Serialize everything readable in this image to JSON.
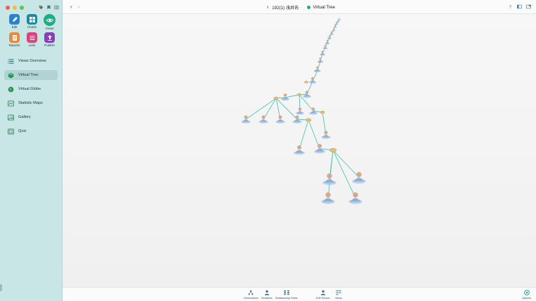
{
  "window": {
    "traffic_lights": [
      "close",
      "minimize",
      "maximize"
    ],
    "toolbar_icons": [
      "tag-icon",
      "bookmark-icon",
      "search-window-icon"
    ]
  },
  "sidebar": {
    "tools": [
      {
        "label": "Edit",
        "icon": "pencil-icon",
        "color": "#2a83cc"
      },
      {
        "label": "Charts",
        "icon": "charts-icon",
        "color": "#1f8a9e"
      },
      {
        "label": "Views",
        "icon": "eye-icon",
        "color": "#1fad84",
        "active": true
      },
      {
        "label": "Reports",
        "icon": "reports-icon",
        "color": "#e88a3a"
      },
      {
        "label": "Lists",
        "icon": "lists-icon",
        "color": "#d6457c"
      },
      {
        "label": "Publish",
        "icon": "publish-icon",
        "color": "#8a3fb8"
      }
    ],
    "nav": [
      {
        "label": "Views Overview",
        "icon": "list-icon"
      },
      {
        "label": "Virtual Tree",
        "icon": "tree-cube-icon",
        "active": true
      },
      {
        "label": "Virtual Globe",
        "icon": "globe-icon"
      },
      {
        "label": "Statistic Maps",
        "icon": "map-icon"
      },
      {
        "label": "Gallery",
        "icon": "gallery-icon"
      },
      {
        "label": "Quiz",
        "icon": "quiz-icon"
      }
    ]
  },
  "header": {
    "back": "‹",
    "forward": "›",
    "person": "192(1) 浅井氏",
    "view_title": "Virtual Tree",
    "right_icons": [
      "help-icon",
      "sidebar-icon",
      "fullscreen-icon"
    ]
  },
  "bottom": {
    "tools": [
      {
        "label": "Generations",
        "icon": "generations-icon"
      },
      {
        "label": "Relatives",
        "icon": "relatives-icon"
      },
      {
        "label": "Relationship Paths",
        "icon": "relationship-paths-icon"
      },
      {
        "label": "Edit Person",
        "icon": "edit-person-icon"
      },
      {
        "label": "Views",
        "icon": "views-icon"
      },
      {
        "label": "Options",
        "icon": "options-icon"
      }
    ]
  },
  "colors": {
    "sidebar": "#c9e6e6",
    "accent": "#1fad84",
    "link_line": "#4cc9b8",
    "person": "#8fb0dc",
    "node": "#e3c07a"
  }
}
